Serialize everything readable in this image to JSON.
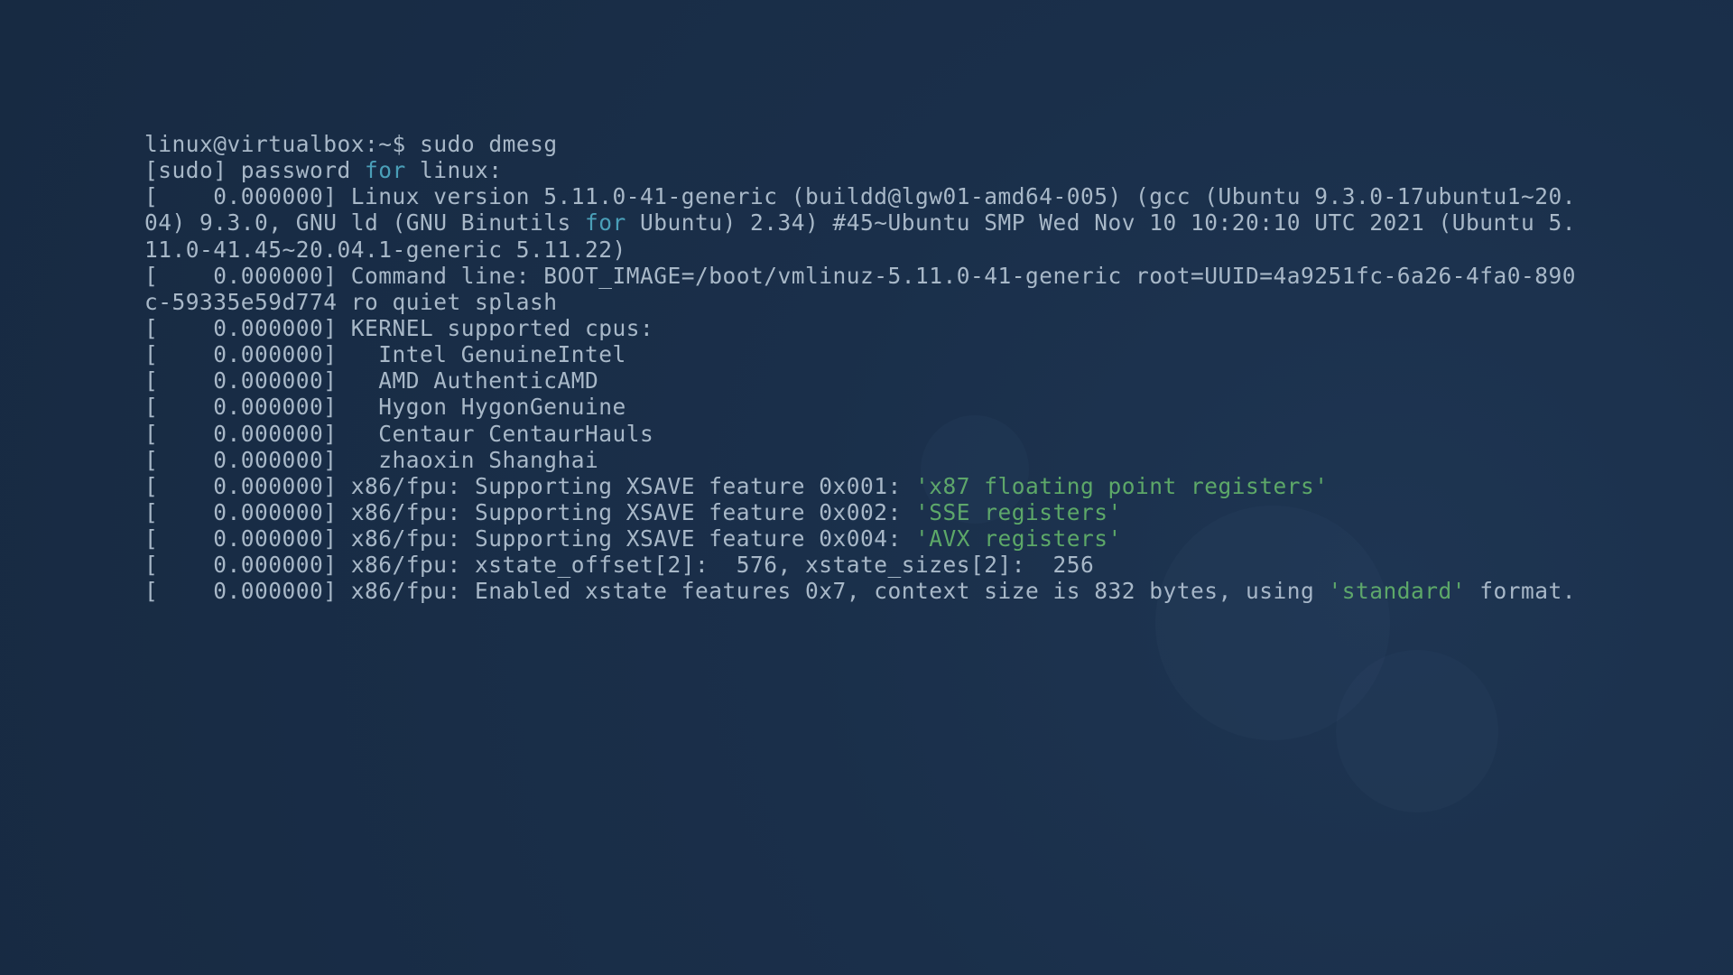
{
  "prompt": {
    "user_host": "linux@virtualbox",
    "path": "~",
    "symbol": "$",
    "command": "sudo dmesg"
  },
  "sudo_prompt": {
    "prefix": "[sudo] password ",
    "for_kw": "for",
    "user": " linux:"
  },
  "dmesg": {
    "linux_version": {
      "ts": "[    0.000000] ",
      "seg1": "Linux version 5.11.0-41-generic (buildd@lgw01-amd64-005) (gcc (Ubuntu 9.3.0-17ubuntu1~20.04) 9.3.0, GNU ld (GNU Binutils ",
      "for_kw": "for",
      "seg2": " Ubuntu) 2.34) #45~Ubuntu SMP Wed Nov 10 10:20:10 UTC 2021 (Ubuntu 5.11.0-41.45~20.04.1-generic 5.11.22)"
    },
    "cmdline": "[    0.000000] Command line: BOOT_IMAGE=/boot/vmlinuz-5.11.0-41-generic root=UUID=4a9251fc-6a26-4fa0-890c-59335e59d774 ro quiet splash",
    "kernel_cpus": "[    0.000000] KERNEL supported cpus:",
    "cpu_intel": "[    0.000000]   Intel GenuineIntel",
    "cpu_amd": "[    0.000000]   AMD AuthenticAMD",
    "cpu_hygon": "[    0.000000]   Hygon HygonGenuine",
    "cpu_centaur": "[    0.000000]   Centaur CentaurHauls",
    "cpu_zhaoxin": "[    0.000000]   zhaoxin Shanghai",
    "fpu1": {
      "pre": "[    0.000000] x86/fpu: Supporting XSAVE feature 0x001: ",
      "str": "'x87 floating point registers'"
    },
    "fpu2": {
      "pre": "[    0.000000] x86/fpu: Supporting XSAVE feature 0x002: ",
      "str": "'SSE registers'"
    },
    "fpu3": {
      "pre": "[    0.000000] x86/fpu: Supporting XSAVE feature 0x004: ",
      "str": "'AVX registers'"
    },
    "xstate": "[    0.000000] x86/fpu: xstate_offset[2]:  576, xstate_sizes[2]:  256",
    "enabled": {
      "pre": "[    0.000000] x86/fpu: Enabled xstate features 0x7, context size is 832 bytes, using ",
      "str": "'standard'",
      "post": " format."
    }
  }
}
